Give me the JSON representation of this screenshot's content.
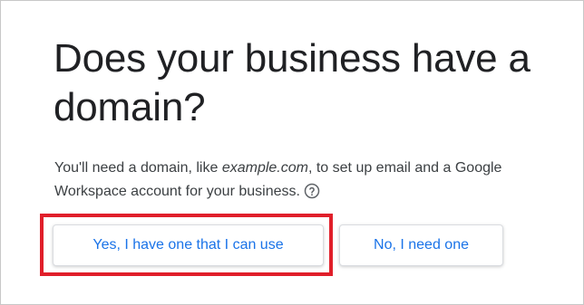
{
  "dialog": {
    "title": "Does your business have a domain?",
    "description_before": "You'll need a domain, like ",
    "description_example": "example.com",
    "description_after": ", to set up email and a Google Workspace account for your business.",
    "help_icon": "help-circle-icon"
  },
  "buttons": {
    "yes_label": "Yes, I have one that I can use",
    "no_label": "No, I need one"
  },
  "colors": {
    "accent": "#1a73e8",
    "highlight": "#e01f2a",
    "title_text": "#202124",
    "body_text": "#3c4043"
  }
}
